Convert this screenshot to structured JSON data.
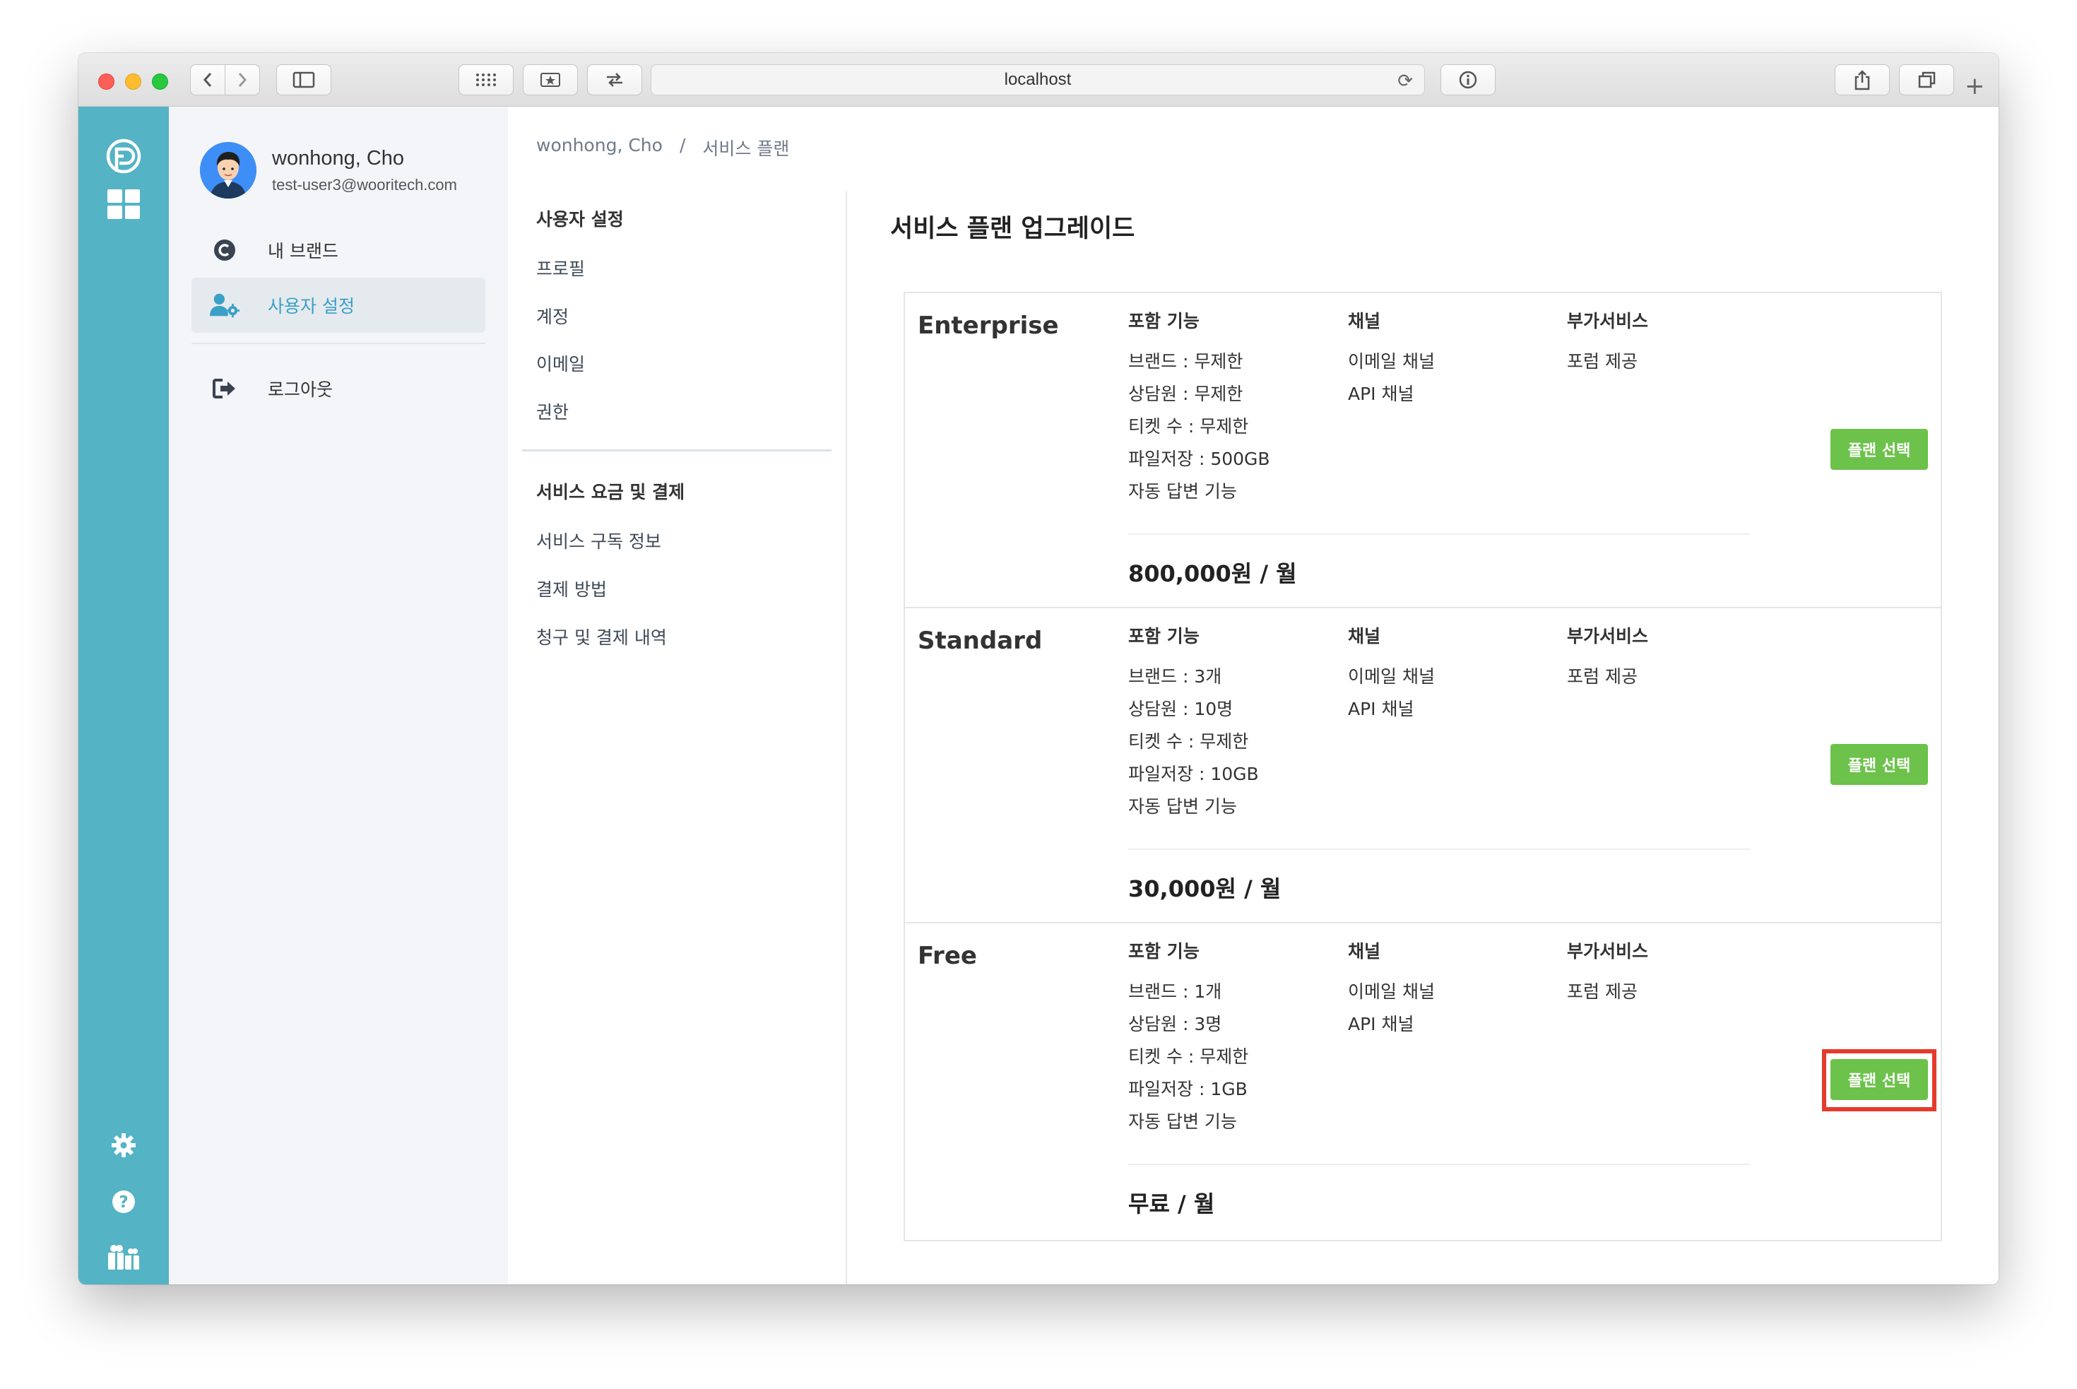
{
  "browser": {
    "url": "localhost"
  },
  "profile": {
    "name": "wonhong, Cho",
    "email": "test-user3@wooritech.com"
  },
  "nav": {
    "items": [
      {
        "label": "내 브랜드",
        "icon": "c-circle-icon"
      },
      {
        "label": "사용자 설정",
        "icon": "user-gear-icon"
      },
      {
        "label": "로그아웃",
        "icon": "logout-icon"
      }
    ]
  },
  "breadcrumb": {
    "user": "wonhong, Cho",
    "sep": "/",
    "current": "서비스 플랜"
  },
  "settings_menu": {
    "user_section": "사용자 설정",
    "user_links": [
      "프로필",
      "계정",
      "이메일",
      "권한"
    ],
    "billing_section": "서비스 요금 및 결제",
    "billing_links": [
      "서비스 구독 정보",
      "결제 방법",
      "청구 및 결제 내역"
    ]
  },
  "page": {
    "title": "서비스 플랜 업그레이드"
  },
  "plans": [
    {
      "name": "Enterprise",
      "features_head": "포함 기능",
      "features": [
        "브랜드 : 무제한",
        "상담원 : 무제한",
        "티켓 수 : 무제한",
        "파일저장 : 500GB",
        "자동 답변 기능"
      ],
      "channels_head": "채널",
      "channels": [
        "이메일 채널",
        "API 채널"
      ],
      "addons_head": "부가서비스",
      "addons": [
        "포럼 제공"
      ],
      "price": "800,000원 / 월",
      "button": "플랜 선택"
    },
    {
      "name": "Standard",
      "features_head": "포함 기능",
      "features": [
        "브랜드 : 3개",
        "상담원 : 10명",
        "티켓 수 : 무제한",
        "파일저장 : 10GB",
        "자동 답변 기능"
      ],
      "channels_head": "채널",
      "channels": [
        "이메일 채널",
        "API 채널"
      ],
      "addons_head": "부가서비스",
      "addons": [
        "포럼 제공"
      ],
      "price": "30,000원 / 월",
      "button": "플랜 선택"
    },
    {
      "name": "Free",
      "features_head": "포함 기능",
      "features": [
        "브랜드 : 1개",
        "상담원 : 3명",
        "티켓 수 : 무제한",
        "파일저장 : 1GB",
        "자동 답변 기능"
      ],
      "channels_head": "채널",
      "channels": [
        "이메일 채널",
        "API 채널"
      ],
      "addons_head": "부가서비스",
      "addons": [
        "포럼 제공"
      ],
      "price": "무료 / 월",
      "button": "플랜 선택",
      "highlighted": true
    }
  ],
  "colors": {
    "rail": "#54b3c4",
    "active_text": "#3aa0c6",
    "select_button": "#6cc24a",
    "highlight_box": "#e53b2c"
  }
}
